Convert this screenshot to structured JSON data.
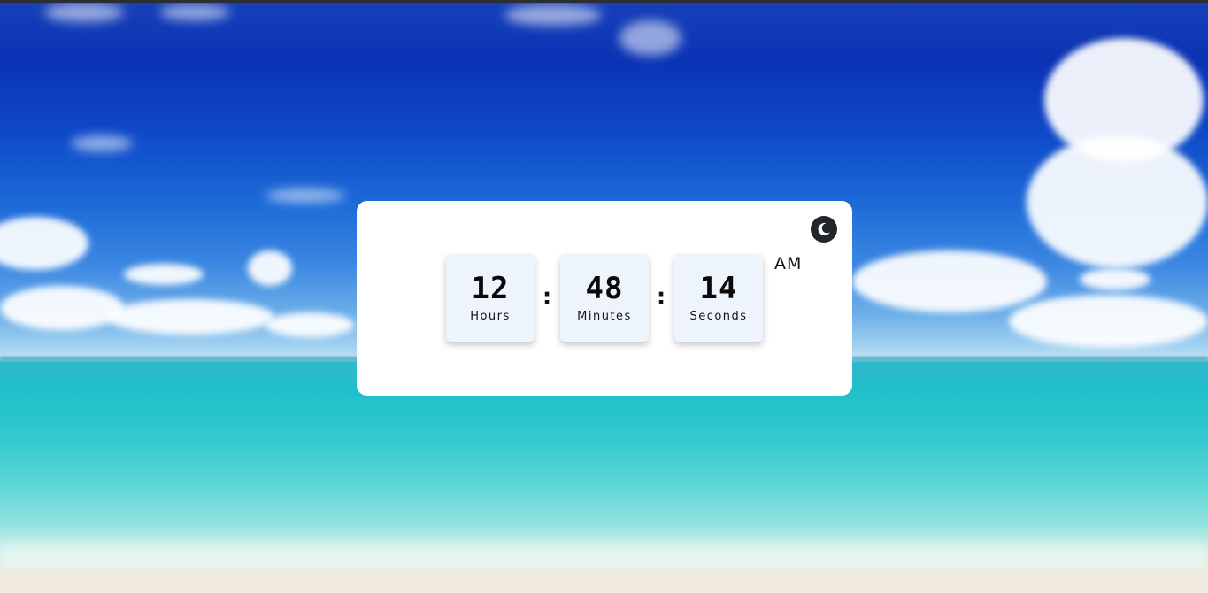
{
  "clock": {
    "hours": "12",
    "hours_label": "Hours",
    "minutes": "48",
    "minutes_label": "Minutes",
    "seconds": "14",
    "seconds_label": "Seconds",
    "separator": ":",
    "period": "AM"
  },
  "theme_toggle": {
    "icon": "moon-icon"
  },
  "colors": {
    "card": "#ffffff",
    "box": "#eef4fc",
    "toggle": "#22262b",
    "digits": "#0a0a0a"
  }
}
